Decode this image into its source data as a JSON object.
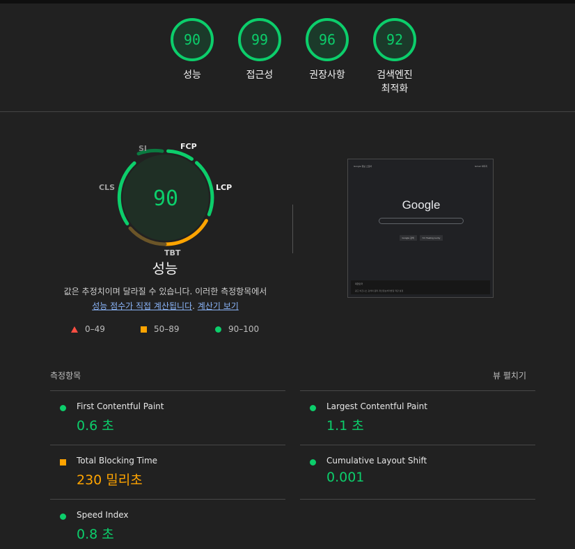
{
  "categories": [
    {
      "score": "90",
      "label": "성능"
    },
    {
      "score": "99",
      "label": "접근성"
    },
    {
      "score": "96",
      "label": "권장사항"
    },
    {
      "score": "92",
      "label": "검색엔진 최적화"
    }
  ],
  "performance": {
    "score": "90",
    "title": "성능",
    "segments": {
      "fcp": "FCP",
      "lcp": "LCP",
      "tbt": "TBT",
      "cls": "CLS",
      "si": "SI"
    },
    "note_text": "값은 추정치이며 달라질 수 있습니다. 이러한 측정항목에서",
    "note_link1": "성능 점수가 직접 계산됩니다",
    "note_sep": ".",
    "note_link2": "계산기 보기"
  },
  "legend": [
    {
      "range": "0–49",
      "color": "#ff4e42",
      "icon": "triangle-icon"
    },
    {
      "range": "50–89",
      "color": "#ffa400",
      "icon": "square-icon"
    },
    {
      "range": "90–100",
      "color": "#0cce6b",
      "icon": "circle-icon"
    }
  ],
  "screenshot": {
    "logo": "Google",
    "top_left": "Google 정보  스토어",
    "top_right": "Gmail  이미지",
    "button1": "Google 검색",
    "button2": "I'm Feeling Lucky",
    "footer_country": "대한민국",
    "footer_links": "광고  비즈니스  검색의 원리         개인정보처리방침  약관  설정"
  },
  "metrics_section": {
    "title": "측정항목",
    "expand": "뷰 펼치기"
  },
  "metrics": [
    {
      "name": "First Contentful Paint",
      "value": "0.6 초",
      "status": "pass"
    },
    {
      "name": "Largest Contentful Paint",
      "value": "1.1 초",
      "status": "pass"
    },
    {
      "name": "Total Blocking Time",
      "value": "230 밀리초",
      "status": "average"
    },
    {
      "name": "Cumulative Layout Shift",
      "value": "0.001",
      "status": "pass"
    },
    {
      "name": "Speed Index",
      "value": "0.8 초",
      "status": "pass"
    }
  ],
  "colors": {
    "pass": "#0cce6b",
    "average": "#ffa400",
    "fail": "#ff4e42",
    "background": "#212121"
  }
}
